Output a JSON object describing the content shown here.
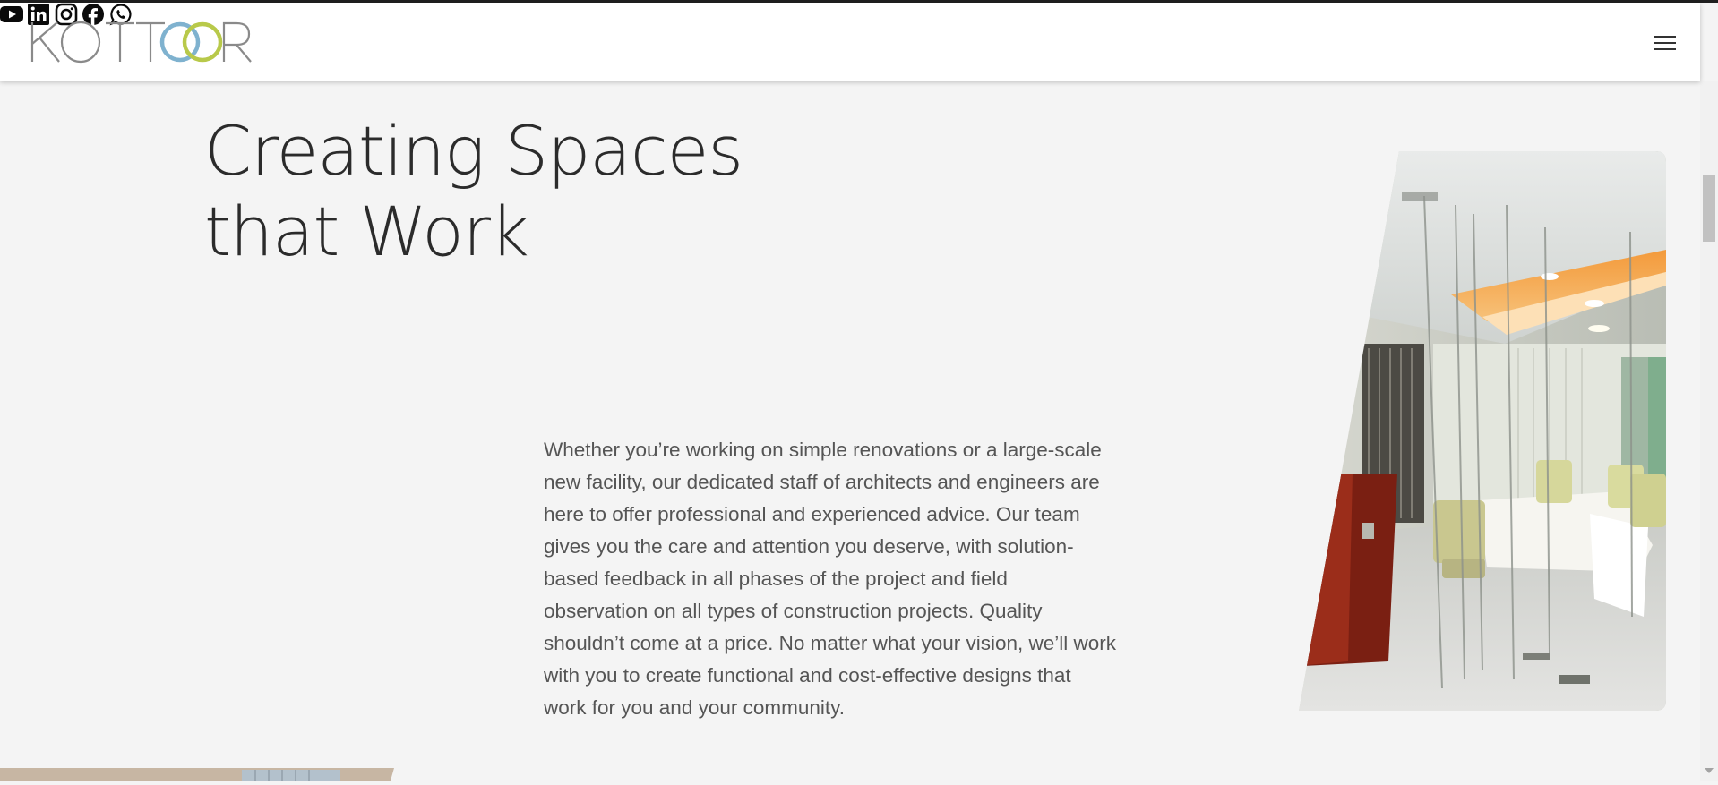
{
  "header": {
    "logo_text": "KOTTOOR",
    "social": [
      {
        "name": "youtube",
        "icon": "youtube-icon"
      },
      {
        "name": "linkedin",
        "icon": "linkedin-icon"
      },
      {
        "name": "instagram",
        "icon": "instagram-icon"
      },
      {
        "name": "facebook",
        "icon": "facebook-icon"
      },
      {
        "name": "whatsapp",
        "icon": "whatsapp-icon"
      }
    ],
    "menu_icon": "hamburger-menu-icon"
  },
  "hero": {
    "title_line1": "Creating Spaces",
    "title_line2": "that Work",
    "paragraph": "Whether you’re working on simple renovations or a large-scale new facility, our dedicated staff of architects and engineers are here to offer professional and experienced advice. Our team gives you the care and attention you deserve, with solution-based feedback in all phases of the project and field observation on all types of construction projects. Quality shouldn’t come at a price. No matter what your vision, we’ll work with you to create functional and cost-effective designs that work for you and your community.",
    "image": "office-interior-photo"
  },
  "colors": {
    "logo_blue": "#7fb2cf",
    "logo_green": "#b8c94a",
    "logo_grey": "#8a8a8a",
    "page_bg": "#f4f4f4"
  }
}
